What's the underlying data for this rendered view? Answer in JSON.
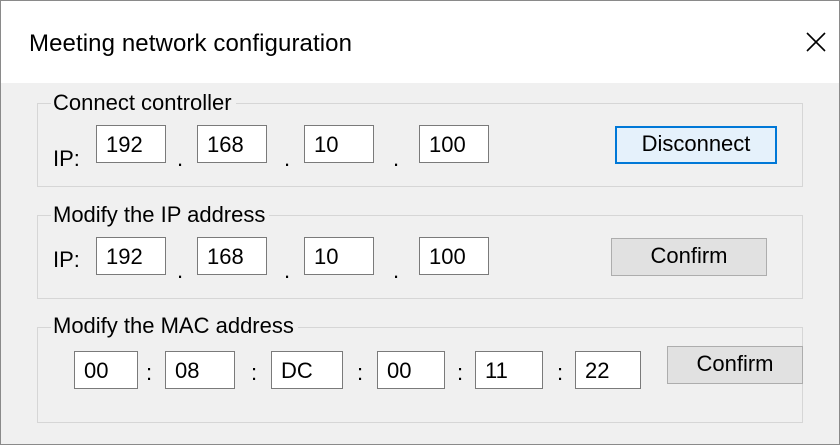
{
  "window": {
    "title": "Meeting network configuration",
    "close_glyph": "close-icon"
  },
  "connect": {
    "label": "Connect controller",
    "ip_label": "IP:",
    "octets": [
      "192",
      "168",
      "10",
      "100"
    ],
    "separator": ".",
    "button_label": "Disconnect"
  },
  "modify_ip": {
    "label": "Modify the IP address",
    "ip_label": "IP:",
    "octets": [
      "192",
      "168",
      "10",
      "100"
    ],
    "separator": ".",
    "button_label": "Confirm"
  },
  "modify_mac": {
    "label": "Modify the MAC address",
    "bytes": [
      "00",
      "08",
      "DC",
      "00",
      "11",
      "22"
    ],
    "separator": ":",
    "button_label": "Confirm"
  },
  "colors": {
    "dialog_bg": "#f0f0f0",
    "title_bg": "#ffffff",
    "focus_accent": "#0078d7"
  }
}
